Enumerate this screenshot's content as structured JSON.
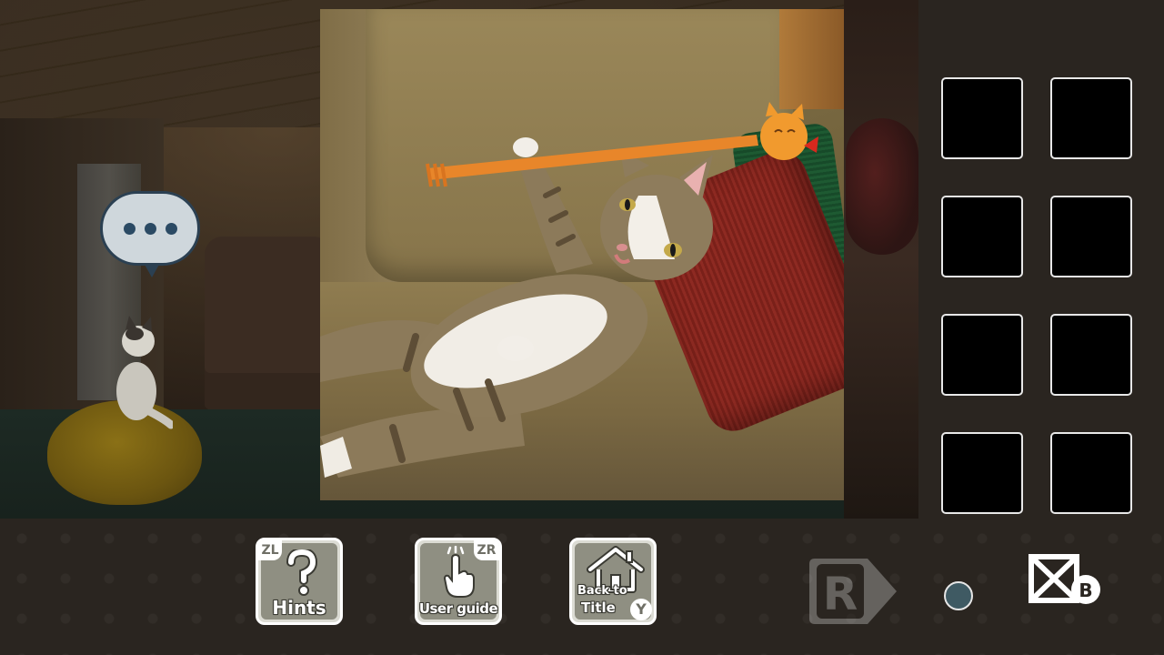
{
  "scene": {
    "thought_bubble_dots": 3
  },
  "inventory": {
    "slots": [
      {
        "index": 1,
        "item": ""
      },
      {
        "index": 2,
        "item": ""
      },
      {
        "index": 3,
        "item": ""
      },
      {
        "index": 4,
        "item": ""
      },
      {
        "index": 5,
        "item": ""
      },
      {
        "index": 6,
        "item": ""
      },
      {
        "index": 7,
        "item": ""
      },
      {
        "index": 8,
        "item": ""
      }
    ]
  },
  "bottom_bar": {
    "hints": {
      "label": "Hints",
      "key": "ZL",
      "icon": "question-mark-icon"
    },
    "user_guide": {
      "label": "User guide",
      "key": "ZR",
      "icon": "pointing-hand-icon"
    },
    "back_to_title": {
      "label_line1": "Back to",
      "label_line2": "Title",
      "key": "Y",
      "icon": "house-icon"
    },
    "next": {
      "key": "R",
      "icon": "arrow-right-icon",
      "state": "disabled"
    },
    "close": {
      "key": "B",
      "icon": "close-box-icon"
    }
  },
  "colors": {
    "background": "#2a2520",
    "slot_fill": "#000000",
    "slot_border": "#e8e8e8",
    "button_face": "#8f8f82",
    "bubble_fill": "#cfd7dc",
    "bubble_dots": "#2b4a64",
    "indicator": "#3f5a63"
  }
}
